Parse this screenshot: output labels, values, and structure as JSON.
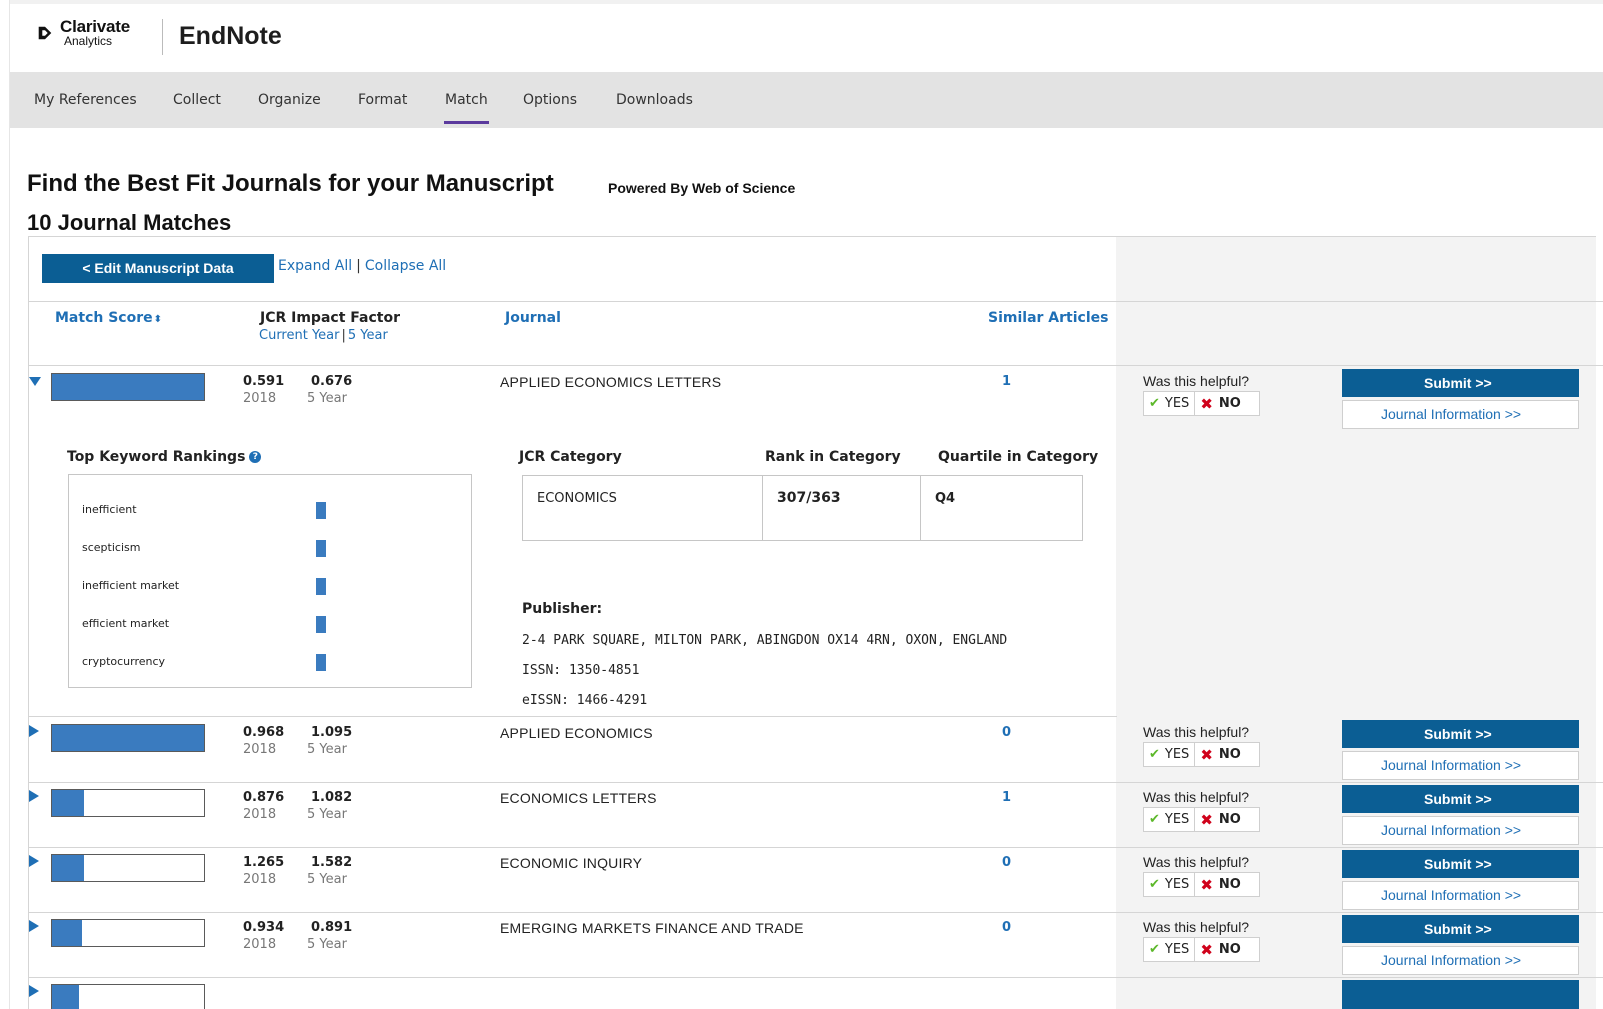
{
  "brand": {
    "company": "Clarivate",
    "company_sub": "Analytics",
    "app": "EndNote"
  },
  "nav": [
    {
      "label": "My References"
    },
    {
      "label": "Collect"
    },
    {
      "label": "Organize"
    },
    {
      "label": "Format"
    },
    {
      "label": "Match",
      "active": true
    },
    {
      "label": "Options"
    },
    {
      "label": "Downloads"
    }
  ],
  "page": {
    "title": "Find the Best Fit Journals for your Manuscript",
    "powered_by": "Powered By Web of Science",
    "matches_heading": "10 Journal Matches",
    "edit_button": "< Edit Manuscript Data",
    "expand_all": "Expand All",
    "separator": "|",
    "collapse_all": "Collapse All"
  },
  "columns": {
    "match_score": "Match Score",
    "match_score_sort_glyph": "⬍",
    "jcr": "JCR Impact Factor",
    "jcr_current": "Current Year",
    "jcr_5year": "5 Year",
    "journal": "Journal",
    "similar": "Similar Articles"
  },
  "feedback": {
    "question": "Was this helpful?",
    "yes": "YES",
    "no": "NO",
    "submit": "Submit >>",
    "journal_info": "Journal Information >>"
  },
  "journals": [
    {
      "score": 1.0,
      "if_current": "0.591",
      "if_5year": "0.676",
      "year": "2018",
      "year_label": "5 Year",
      "name": "APPLIED ECONOMICS LETTERS",
      "similar": "1",
      "expanded": true
    },
    {
      "score": 1.0,
      "if_current": "0.968",
      "if_5year": "1.095",
      "year": "2018",
      "year_label": "5 Year",
      "name": "APPLIED ECONOMICS",
      "similar": "0"
    },
    {
      "score": 0.21,
      "if_current": "0.876",
      "if_5year": "1.082",
      "year": "2018",
      "year_label": "5 Year",
      "name": "ECONOMICS LETTERS",
      "similar": "1"
    },
    {
      "score": 0.21,
      "if_current": "1.265",
      "if_5year": "1.582",
      "year": "2018",
      "year_label": "5 Year",
      "name": "ECONOMIC INQUIRY",
      "similar": "0"
    },
    {
      "score": 0.2,
      "if_current": "0.934",
      "if_5year": "0.891",
      "year": "2018",
      "year_label": "5 Year",
      "name": "EMERGING MARKETS FINANCE AND TRADE",
      "similar": "0"
    }
  ],
  "details": {
    "keyword_title": "Top Keyword Rankings",
    "keywords": [
      "inefficient",
      "scepticism",
      "inefficient market",
      "efficient market",
      "cryptocurrency"
    ],
    "category_header": "JCR Category",
    "rank_header": "Rank in Category",
    "quartile_header": "Quartile in Category",
    "category": "ECONOMICS",
    "rank": "307/363",
    "quartile": "Q4",
    "publisher_label": "Publisher:",
    "publisher_address": "2-4 PARK SQUARE, MILTON PARK, ABINGDON OX14 4RN, OXON, ENGLAND",
    "issn": "ISSN: 1350-4851",
    "eissn": "eISSN: 1466-4291"
  },
  "colors": {
    "accent": "#0b5e94",
    "link": "#1f6fb5",
    "score_bar": "#3a7bbf",
    "nav_active": "#5b3a9d"
  }
}
